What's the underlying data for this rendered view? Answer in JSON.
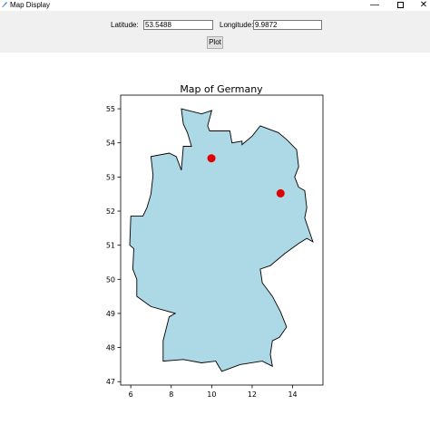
{
  "window": {
    "title": "Map Display",
    "icon": "feather-icon",
    "minimize_glyph": "—",
    "close_glyph": "✕"
  },
  "form": {
    "latitude_label": "Latitude:",
    "latitude_value": "53.5488",
    "longitude_label": "Longitude:",
    "longitude_value": "9.9872",
    "plot_button": "Plot"
  },
  "chart_data": {
    "type": "scatter",
    "title": "Map of Germany",
    "xlabel": "",
    "ylabel": "",
    "xlim": [
      5.5,
      15.5
    ],
    "ylim": [
      46.9,
      55.4
    ],
    "xticks": [
      6,
      8,
      10,
      12,
      14
    ],
    "yticks": [
      47,
      48,
      49,
      50,
      51,
      52,
      53,
      54,
      55
    ],
    "grid": false,
    "colors": {
      "land_fill": "#add8e6",
      "land_edge": "#000000",
      "marker": "#e00000"
    },
    "outline": [
      [
        8.5,
        55.0
      ],
      [
        9.5,
        54.85
      ],
      [
        10.0,
        54.95
      ],
      [
        9.8,
        54.5
      ],
      [
        9.9,
        54.35
      ],
      [
        10.9,
        54.35
      ],
      [
        11.0,
        54.0
      ],
      [
        11.5,
        54.05
      ],
      [
        11.5,
        53.95
      ],
      [
        12.0,
        54.2
      ],
      [
        12.4,
        54.5
      ],
      [
        13.3,
        54.3
      ],
      [
        13.7,
        54.1
      ],
      [
        14.2,
        53.8
      ],
      [
        14.3,
        53.3
      ],
      [
        14.1,
        53.0
      ],
      [
        14.3,
        52.7
      ],
      [
        14.6,
        52.6
      ],
      [
        14.7,
        52.1
      ],
      [
        14.6,
        51.8
      ],
      [
        15.0,
        51.1
      ],
      [
        14.7,
        51.2
      ],
      [
        14.3,
        51.05
      ],
      [
        13.6,
        50.75
      ],
      [
        12.9,
        50.4
      ],
      [
        12.4,
        50.3
      ],
      [
        12.5,
        49.9
      ],
      [
        13.0,
        49.5
      ],
      [
        13.4,
        49.05
      ],
      [
        13.7,
        48.6
      ],
      [
        13.35,
        48.3
      ],
      [
        13.0,
        48.2
      ],
      [
        12.9,
        47.8
      ],
      [
        13.0,
        47.45
      ],
      [
        12.5,
        47.6
      ],
      [
        11.4,
        47.5
      ],
      [
        10.5,
        47.3
      ],
      [
        10.2,
        47.6
      ],
      [
        9.5,
        47.55
      ],
      [
        8.6,
        47.65
      ],
      [
        7.6,
        47.6
      ],
      [
        7.6,
        48.2
      ],
      [
        7.9,
        48.9
      ],
      [
        8.2,
        49.0
      ],
      [
        7.0,
        49.2
      ],
      [
        6.3,
        49.5
      ],
      [
        6.3,
        50.0
      ],
      [
        6.1,
        50.3
      ],
      [
        6.15,
        50.9
      ],
      [
        5.95,
        51.0
      ],
      [
        6.0,
        51.85
      ],
      [
        6.6,
        51.85
      ],
      [
        6.8,
        52.1
      ],
      [
        7.0,
        52.5
      ],
      [
        7.1,
        53.05
      ],
      [
        7.0,
        53.6
      ],
      [
        7.9,
        53.7
      ],
      [
        8.25,
        53.6
      ],
      [
        8.5,
        53.2
      ],
      [
        8.6,
        53.9
      ],
      [
        9.0,
        53.9
      ],
      [
        8.8,
        54.3
      ],
      [
        8.6,
        54.55
      ],
      [
        8.5,
        55.0
      ]
    ],
    "points": [
      {
        "x": 9.9872,
        "y": 53.5488
      },
      {
        "x": 13.405,
        "y": 52.52
      }
    ]
  }
}
